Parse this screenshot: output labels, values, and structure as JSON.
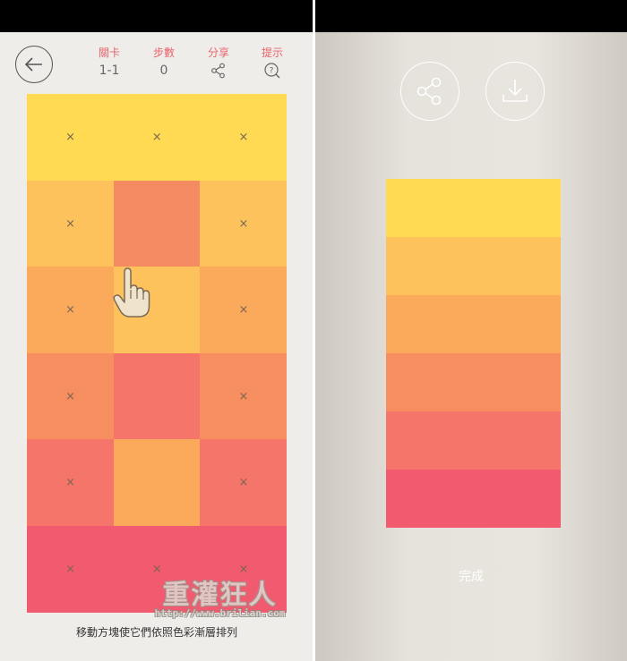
{
  "hud": {
    "level_label": "關卡",
    "level_value": "1-1",
    "steps_label": "步數",
    "steps_value": "0",
    "share_label": "分享",
    "hint_label": "提示"
  },
  "grid": {
    "rows": [
      [
        {
          "color": "#ffda52",
          "mark": "×",
          "fixed": true
        },
        {
          "color": "#ffda52",
          "mark": "×",
          "fixed": true
        },
        {
          "color": "#ffda52",
          "mark": "×",
          "fixed": true
        }
      ],
      [
        {
          "color": "#fdc25c",
          "mark": "×",
          "fixed": true
        },
        {
          "color": "#f58b63",
          "mark": "",
          "fixed": false
        },
        {
          "color": "#fdc25c",
          "mark": "×",
          "fixed": true
        }
      ],
      [
        {
          "color": "#fbaa5c",
          "mark": "×",
          "fixed": true
        },
        {
          "color": "#fdc25c",
          "mark": "",
          "fixed": false
        },
        {
          "color": "#fbaa5c",
          "mark": "×",
          "fixed": true
        }
      ],
      [
        {
          "color": "#f68e60",
          "mark": "×",
          "fixed": true
        },
        {
          "color": "#f5756a",
          "mark": "",
          "fixed": false
        },
        {
          "color": "#f68e60",
          "mark": "×",
          "fixed": true
        }
      ],
      [
        {
          "color": "#f5756a",
          "mark": "×",
          "fixed": true
        },
        {
          "color": "#fbaa5c",
          "mark": "",
          "fixed": false
        },
        {
          "color": "#f5756a",
          "mark": "×",
          "fixed": true
        }
      ],
      [
        {
          "color": "#f25a70",
          "mark": "×",
          "fixed": true
        },
        {
          "color": "#f25a70",
          "mark": "×",
          "fixed": true
        },
        {
          "color": "#f25a70",
          "mark": "×",
          "fixed": true
        }
      ]
    ]
  },
  "instruction": "移動方塊使它們依照色彩漸層排列",
  "result": {
    "stripes": [
      "#ffda52",
      "#fdc25c",
      "#fbaa5c",
      "#f68e60",
      "#f5756a",
      "#f25a70"
    ],
    "done_label": "完成"
  },
  "watermark": {
    "text": "重灌狂人",
    "url": "http://www.brilian.com"
  },
  "icons": {
    "back": "arrow-left-icon",
    "share": "share-icon",
    "hint": "question-magnifier-icon",
    "download": "download-icon",
    "hand": "pointing-hand-icon"
  }
}
